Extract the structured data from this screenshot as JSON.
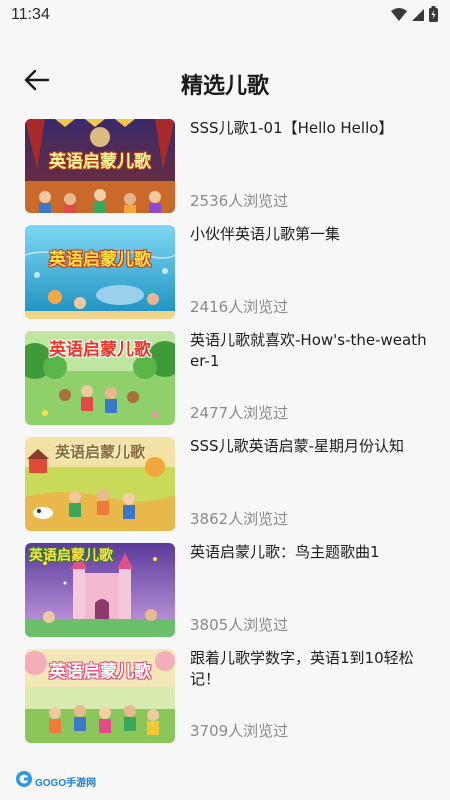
{
  "status_bar": {
    "time": "11:34"
  },
  "header": {
    "title": "精选儿歌"
  },
  "items": [
    {
      "title": "SSS儿歌1-01【Hello Hello】",
      "views": "2536人浏览过",
      "thumb_text": "英语启蒙儿歌"
    },
    {
      "title": "小伙伴英语儿歌第一集",
      "views": "2416人浏览过",
      "thumb_text": "英语启蒙儿歌"
    },
    {
      "title": "英语儿歌就喜欢-How's-the-weather-1",
      "views": "2477人浏览过",
      "thumb_text": "英语启蒙儿歌"
    },
    {
      "title": "SSS儿歌英语启蒙-星期月份认知",
      "views": "3862人浏览过",
      "thumb_text": "英语启蒙儿歌"
    },
    {
      "title": "英语启蒙儿歌：鸟主题歌曲1",
      "views": "3805人浏览过",
      "thumb_text": "英语启蒙儿歌"
    },
    {
      "title": "跟着儿歌学数字，英语1到10轻松记！",
      "views": "3709人浏览过",
      "thumb_text": "英语启蒙儿歌"
    }
  ],
  "watermark": {
    "text": "GOGO手游网"
  },
  "colors": {
    "background": "#f7f7f7",
    "views_text": "#8a8a8a"
  }
}
